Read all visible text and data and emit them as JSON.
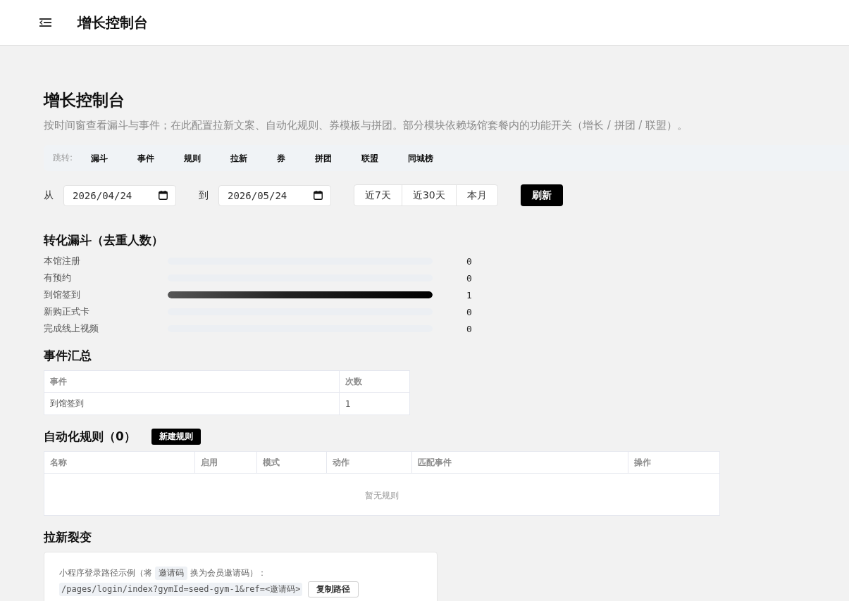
{
  "header": {
    "title": "增长控制台"
  },
  "page": {
    "title": "增长控制台",
    "subtitle": "按时间窗查看漏斗与事件；在此配置拉新文案、自动化规则、券模板与拼团。部分模块依赖场馆套餐内的功能开关（增长 / 拼团 / 联盟）。"
  },
  "jump_bar": {
    "label": "跳转:",
    "links": [
      "漏斗",
      "事件",
      "规则",
      "拉新",
      "券",
      "拼团",
      "联盟",
      "同城榜"
    ]
  },
  "date_range": {
    "from_label": "从",
    "from_value": "2026/04/24",
    "to_label": "到",
    "to_value": "2026/05/24",
    "presets": [
      {
        "label": "近7天",
        "selected": false
      },
      {
        "label": "近30天",
        "selected": false
      },
      {
        "label": "本月",
        "selected": false
      }
    ],
    "refresh_button": "刷新"
  },
  "funnel": {
    "title": "转化漏斗（去重人数）",
    "steps": [
      {
        "label": "本馆注册",
        "level": 0,
        "value": "0"
      },
      {
        "label": "有预约",
        "level": 0,
        "value": "0"
      },
      {
        "label": "到馆签到",
        "level": 1,
        "value": "1"
      },
      {
        "label": "新购正式卡",
        "level": 0,
        "value": "0"
      },
      {
        "label": "完成线上视频",
        "level": 0,
        "value": "0"
      }
    ]
  },
  "event_summary": {
    "title": "事件汇总",
    "columns": [
      "事件",
      "次数"
    ],
    "rows": [
      [
        "到馆签到",
        "1"
      ]
    ]
  },
  "rules": {
    "title": "自动化规则（0）",
    "new_button": "新建规则",
    "columns": [
      "名称",
      "启用",
      "模式",
      "动作",
      "匹配事件",
      "操作"
    ],
    "empty_text": "暂无规则"
  },
  "invite": {
    "title": "拉新裂变",
    "hint_before": "小程序登录路径示例（将",
    "code_token": "邀请码",
    "hint_after": "换为会员邀请码）：",
    "path": "/pages/login/index?gymId=seed-gym-1&ref=<邀请码>",
    "copy_button": "复制路径"
  }
}
